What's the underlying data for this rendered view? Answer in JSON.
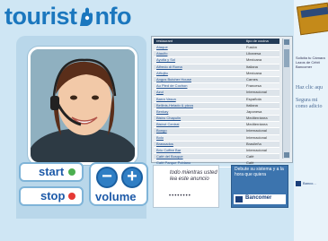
{
  "header": {
    "logo_part1": "tourist",
    "logo_part2": "nfo",
    "logo_icon": "hand-i-icon"
  },
  "player": {
    "photo": "operator-with-headset",
    "start_label": "start",
    "stop_label": "stop",
    "volume_label": "volume",
    "volume_down_symbol": "−",
    "volume_up_symbol": "+",
    "start_color": "#4caf50",
    "stop_color": "#e53935"
  },
  "table": {
    "columns": [
      "restaurant",
      "tipo de cocina"
    ],
    "rows": [
      {
        "name": "Ataque",
        "type": "Fusión"
      },
      {
        "name": "Ataulfo",
        "type": "Libanesa"
      },
      {
        "name": "Ayutla y Sol",
        "type": "Mexicana"
      },
      {
        "name": "Alfredo di Roma",
        "type": "Italiana"
      },
      {
        "name": "Alfiojito",
        "type": "Mexicana"
      },
      {
        "name": "Angus Butcher House",
        "type": "Carnes"
      },
      {
        "name": "Au Pied de Cochon",
        "type": "Francesa"
      },
      {
        "name": "Azul",
        "type": "Internacional"
      },
      {
        "name": "Barra Vasca",
        "type": "Española"
      },
      {
        "name": "Bellinis-Helado & pizza",
        "type": "Italiana"
      },
      {
        "name": "Benkay",
        "type": "Japonesa"
      },
      {
        "name": "Bistro Chapulin",
        "type": "Mediterránea"
      },
      {
        "name": "Bistrot Central",
        "type": "Mediterránea"
      },
      {
        "name": "Bongo",
        "type": "Internacional"
      },
      {
        "name": "Bolo",
        "type": "Internacional"
      },
      {
        "name": "Brassados",
        "type": "Brasileña"
      },
      {
        "name": "Brio Coffee Bar",
        "type": "Internacional"
      },
      {
        "name": "Café del Bosque",
        "type": "Café"
      },
      {
        "name": "Café Parque Poblano",
        "type": "Café"
      }
    ]
  },
  "ads": {
    "ad1_text": "todo mientras usted lea este anuncio",
    "ad1_dots": "••••••••",
    "ad2_text": "Debute su sistema y a la hora que quiera",
    "ad2_brand": "Bancomer"
  },
  "right_ad": {
    "text1": "Solicita tu Cámara Lazos de Cébit Bancomer",
    "cta": "Haz clic aqu",
    "text2": "Segura mi como adicio",
    "footer": "Banco..."
  }
}
